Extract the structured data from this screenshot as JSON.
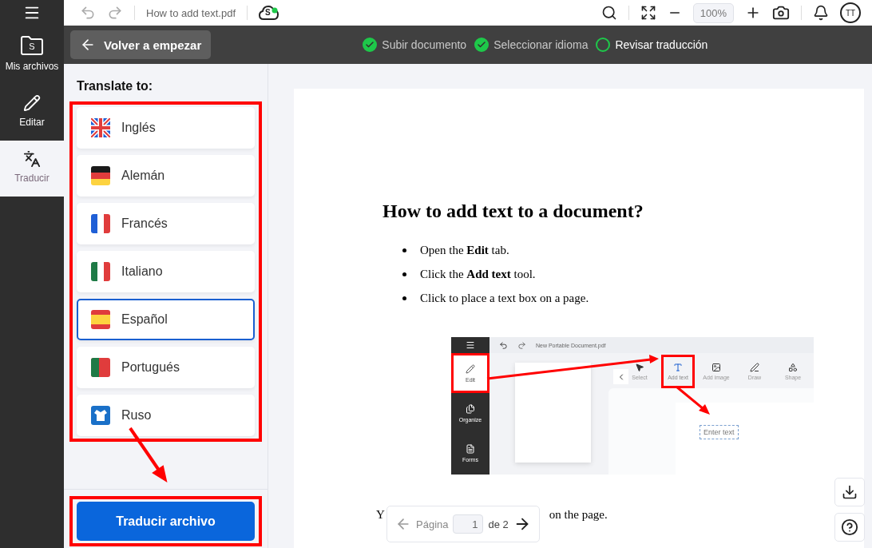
{
  "topbar": {
    "filename": "How to add text.pdf",
    "cloud_letter": "S",
    "zoom": "100%",
    "avatar": "TT"
  },
  "rail": [
    {
      "label": "Mis archivos",
      "kind": "folder",
      "icon_letter": "S",
      "selected": false
    },
    {
      "label": "Editar",
      "kind": "pencil",
      "selected": false
    },
    {
      "label": "Traducir",
      "kind": "translate",
      "selected": true
    }
  ],
  "back_button": "Volver a empezar",
  "steps": [
    {
      "label": "Subir documento",
      "done": true
    },
    {
      "label": "Seleccionar idioma",
      "done": true
    },
    {
      "label": "Revisar traducción",
      "done": false
    }
  ],
  "panel": {
    "heading": "Translate to:",
    "languages": [
      {
        "label": "Inglés",
        "kind": "gb",
        "selected": false
      },
      {
        "label": "Alemán",
        "kind": "de",
        "selected": false
      },
      {
        "label": "Francés",
        "kind": "fr",
        "selected": false
      },
      {
        "label": "Italiano",
        "kind": "it",
        "selected": false
      },
      {
        "label": "Español",
        "kind": "es",
        "selected": true
      },
      {
        "label": "Portugués",
        "kind": "pt",
        "selected": false
      },
      {
        "label": "Ruso",
        "kind": "ru",
        "selected": false
      }
    ],
    "action": "Traducir archivo"
  },
  "document": {
    "title": "How to add text to a document?",
    "bullets": [
      "Open the **Edit** tab.",
      "Click the **Add text** tool.",
      "Click to place a text box on a page."
    ],
    "screenshot": {
      "filename": "New Portable Document.pdf",
      "rail": [
        {
          "label": "Edit",
          "kind": "pencil",
          "highlighted": true
        },
        {
          "label": "Organize",
          "kind": "pages",
          "highlighted": false
        },
        {
          "label": "Forms",
          "kind": "form",
          "highlighted": false
        }
      ],
      "tools": [
        {
          "label": "Select",
          "kind": "cursor",
          "highlighted": false
        },
        {
          "label": "Add text",
          "kind": "text",
          "highlighted": true
        },
        {
          "label": "Add image",
          "kind": "image",
          "highlighted": false
        },
        {
          "label": "Draw",
          "kind": "pen",
          "highlighted": false
        },
        {
          "label": "Shape",
          "kind": "shape",
          "highlighted": false
        }
      ],
      "placeholder": "Enter text"
    },
    "fragment_start": "Y",
    "fragment_end": "on the page."
  },
  "pager": {
    "label": "Página",
    "value": "1",
    "total": "de 2"
  }
}
